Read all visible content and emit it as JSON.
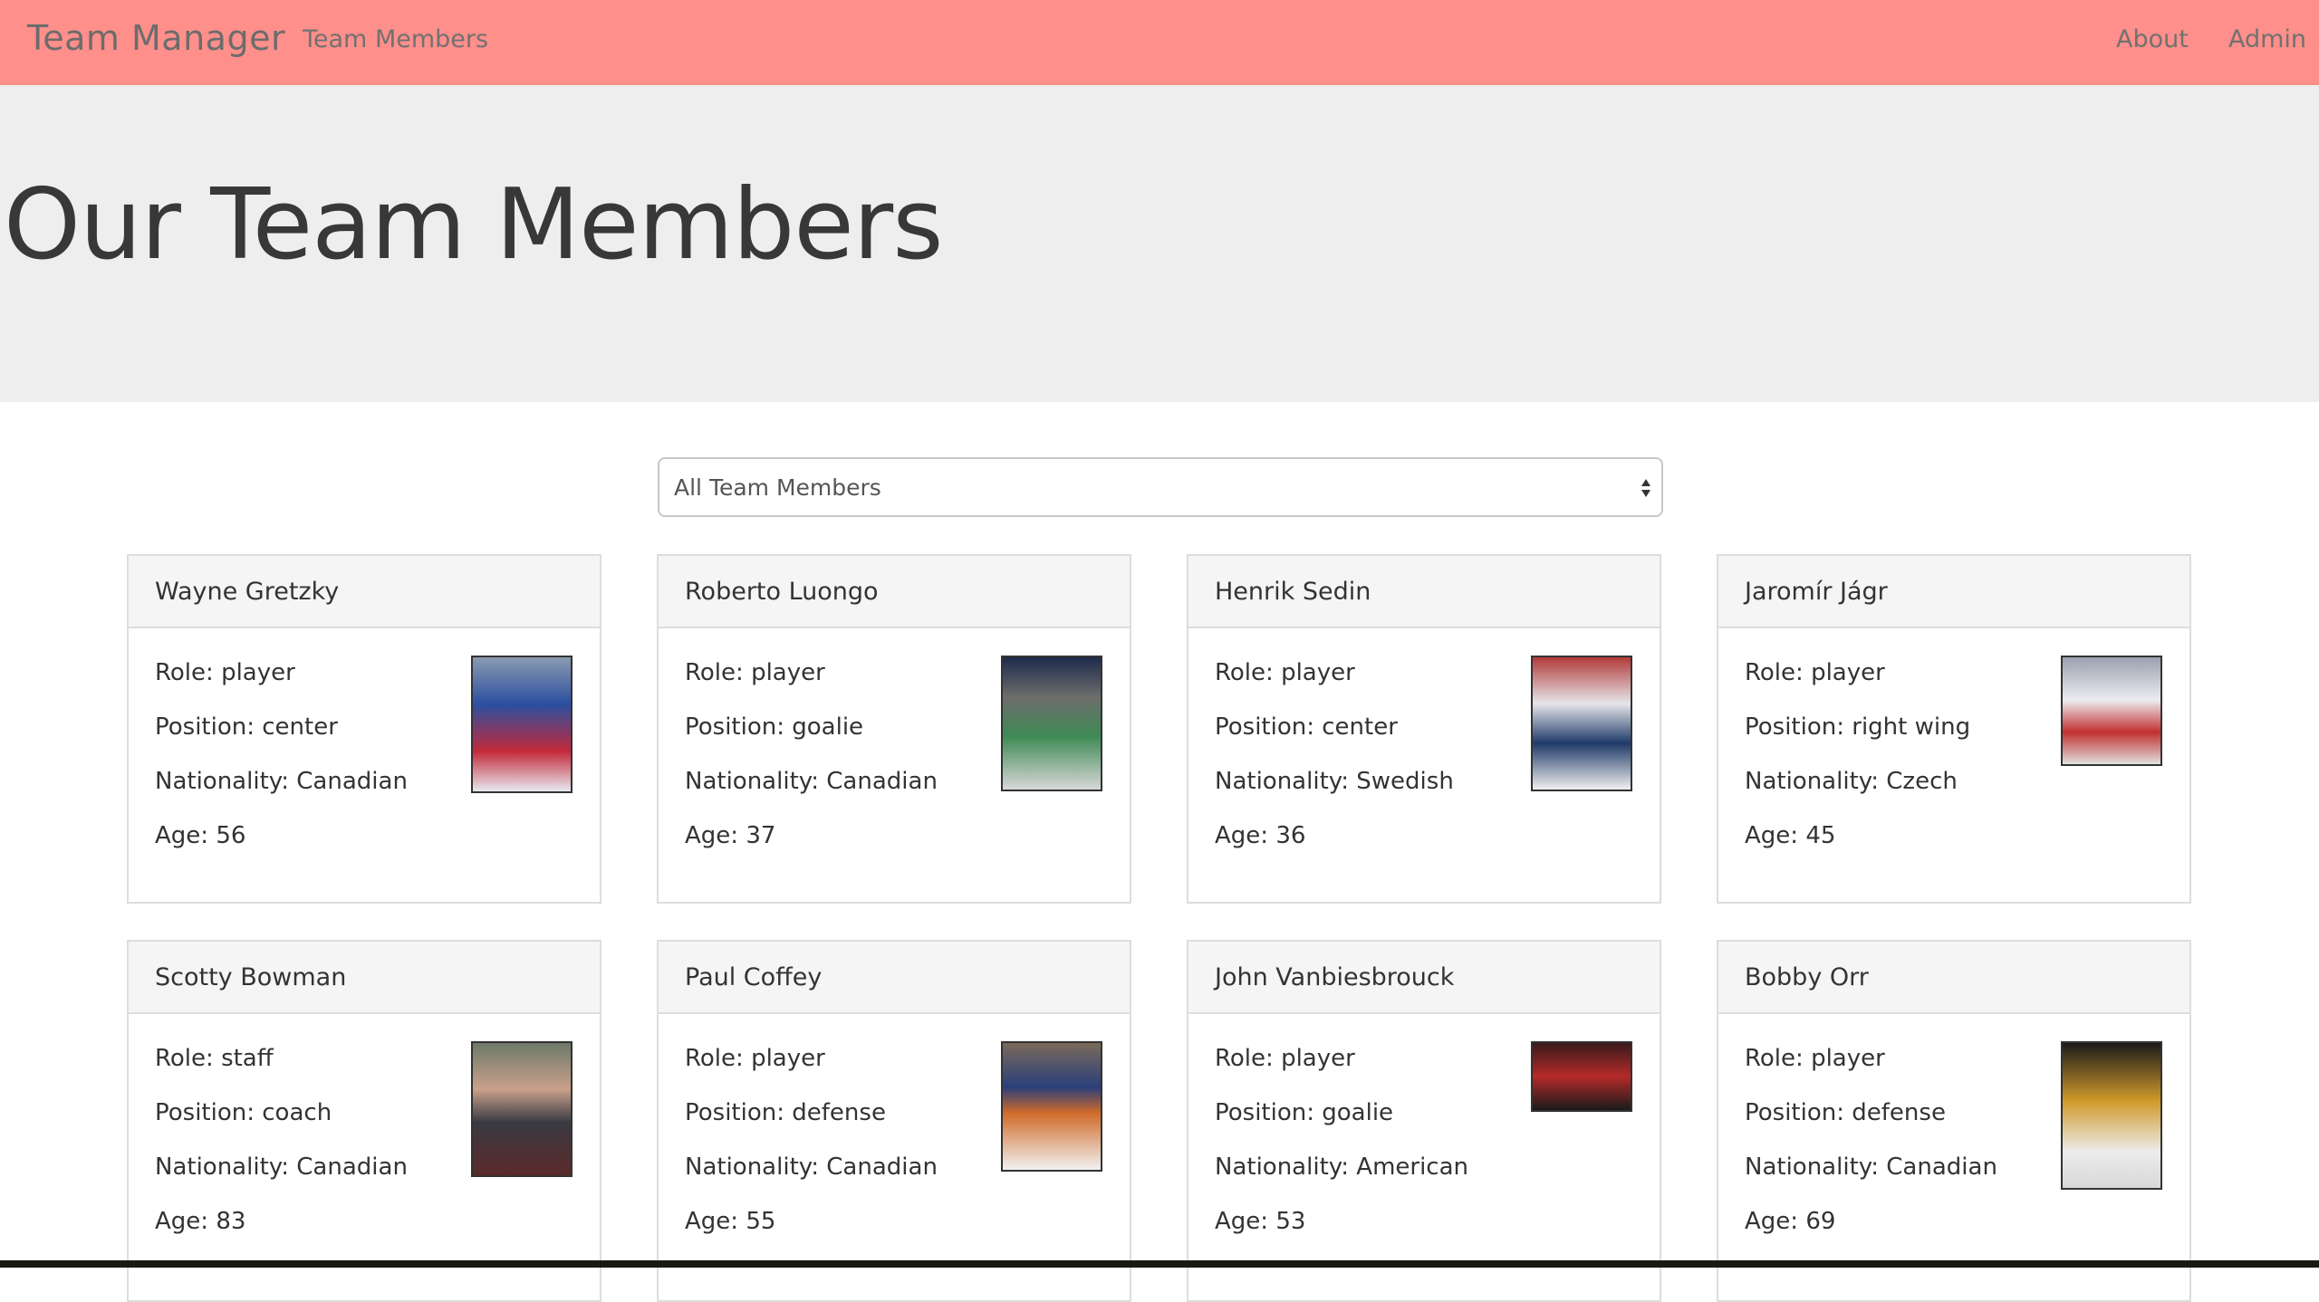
{
  "navbar": {
    "brand": "Team Manager",
    "links": [
      "Team Members",
      "About",
      "Admin"
    ]
  },
  "header": {
    "title": "Our Team Members"
  },
  "filter": {
    "selected": "All Team Members"
  },
  "labels": {
    "role": "Role: ",
    "position": "Position: ",
    "nationality": "Nationality: ",
    "age": "Age: "
  },
  "members": [
    {
      "name": "Wayne Gretzky",
      "role": "player",
      "position": "center",
      "nationality": "Canadian",
      "age": "56"
    },
    {
      "name": "Roberto Luongo",
      "role": "player",
      "position": "goalie",
      "nationality": "Canadian",
      "age": "37"
    },
    {
      "name": "Henrik Sedin",
      "role": "player",
      "position": "center",
      "nationality": "Swedish",
      "age": "36"
    },
    {
      "name": "Jaromír Jágr",
      "role": "player",
      "position": "right wing",
      "nationality": "Czech",
      "age": "45"
    },
    {
      "name": "Scotty Bowman",
      "role": "staff",
      "position": "coach",
      "nationality": "Canadian",
      "age": "83"
    },
    {
      "name": "Paul Coffey",
      "role": "player",
      "position": "defense",
      "nationality": "Canadian",
      "age": "55"
    },
    {
      "name": "John Vanbiesbrouck",
      "role": "player",
      "position": "goalie",
      "nationality": "American",
      "age": "53"
    },
    {
      "name": "Bobby Orr",
      "role": "player",
      "position": "defense",
      "nationality": "Canadian",
      "age": "69"
    }
  ],
  "colors": {
    "navbar": "#ff8f8a",
    "jumbotron": "#eeeeee"
  }
}
